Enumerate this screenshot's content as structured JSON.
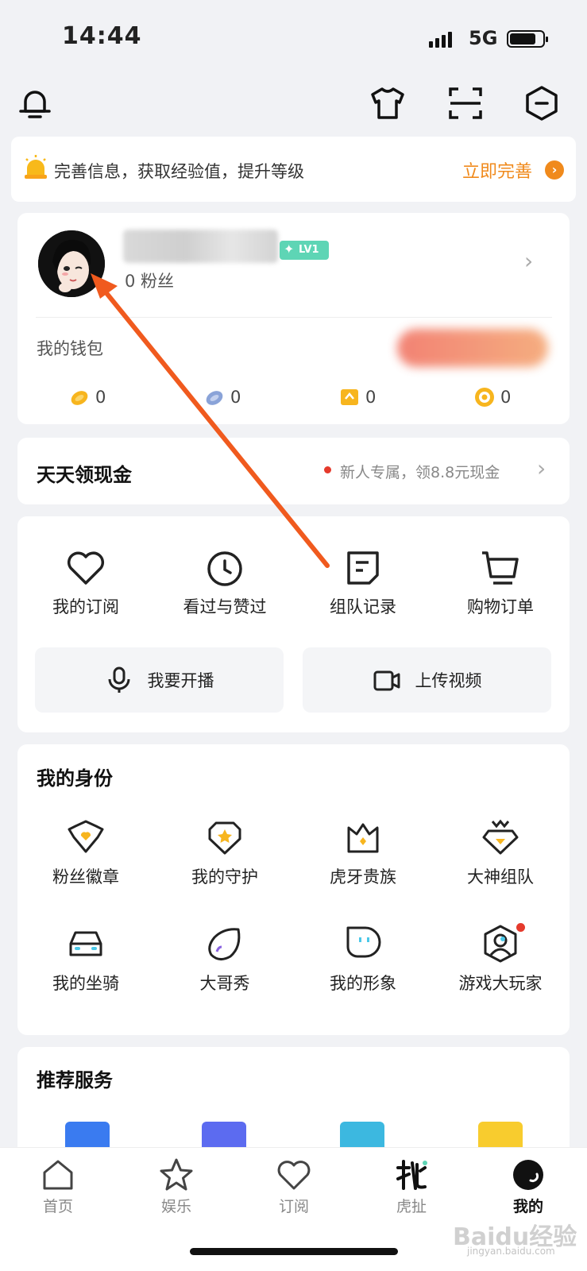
{
  "status_bar": {
    "time": "14:44",
    "network": "5G"
  },
  "header": {
    "icons": [
      "bell-icon",
      "shirt-icon",
      "scan-icon",
      "hexagon-minus-icon"
    ]
  },
  "banner": {
    "text": "完善信息，获取经验值，提升等级",
    "link": "立即完善",
    "accent": "#f08a1c"
  },
  "profile": {
    "level": "LV1",
    "fans": "0 粉丝",
    "wallet_label": "我的钱包",
    "balances": [
      {
        "icon": "gold-bean-icon",
        "value": "0"
      },
      {
        "icon": "silver-bean-icon",
        "value": "0"
      },
      {
        "icon": "ticket-icon",
        "value": "0"
      },
      {
        "icon": "coin-icon",
        "value": "0"
      }
    ]
  },
  "cash": {
    "title": "天天领现金",
    "subtitle": "新人专属，领8.8元现金"
  },
  "actions": {
    "items": [
      {
        "label": "我的订阅",
        "icon": "heart-icon"
      },
      {
        "label": "看过与赞过",
        "icon": "clock-icon"
      },
      {
        "label": "组队记录",
        "icon": "note-icon"
      },
      {
        "label": "购物订单",
        "icon": "cart-icon"
      }
    ],
    "broadcast": "我要开播",
    "upload": "上传视频"
  },
  "identity": {
    "title": "我的身份",
    "items": [
      {
        "label": "粉丝徽章",
        "icon": "fan-badge-icon"
      },
      {
        "label": "我的守护",
        "icon": "guard-shield-icon"
      },
      {
        "label": "虎牙贵族",
        "icon": "crown-icon"
      },
      {
        "label": "大神组队",
        "icon": "diamond-crown-icon"
      },
      {
        "label": "我的坐骑",
        "icon": "car-icon"
      },
      {
        "label": "大哥秀",
        "icon": "bubble-icon"
      },
      {
        "label": "我的形象",
        "icon": "face-icon"
      },
      {
        "label": "游戏大玩家",
        "icon": "player-hexagon-icon"
      }
    ]
  },
  "services": {
    "title": "推荐服务"
  },
  "tabbar": {
    "tabs": [
      {
        "label": "首页",
        "icon": "home-icon"
      },
      {
        "label": "娱乐",
        "icon": "star-icon"
      },
      {
        "label": "订阅",
        "icon": "heart-icon"
      },
      {
        "label": "虎扯",
        "icon": "huche-logo-icon"
      },
      {
        "label": "我的",
        "icon": "profile-icon"
      }
    ],
    "active": "我的"
  },
  "watermark": {
    "text": "Baidu经验",
    "sub": "jingyan.baidu.com"
  },
  "colors": {
    "accent_orange": "#f08a1c",
    "arrow": "#f05a1e",
    "level_badge": "#5ed5b5",
    "notice_dot": "#e53a2c"
  }
}
